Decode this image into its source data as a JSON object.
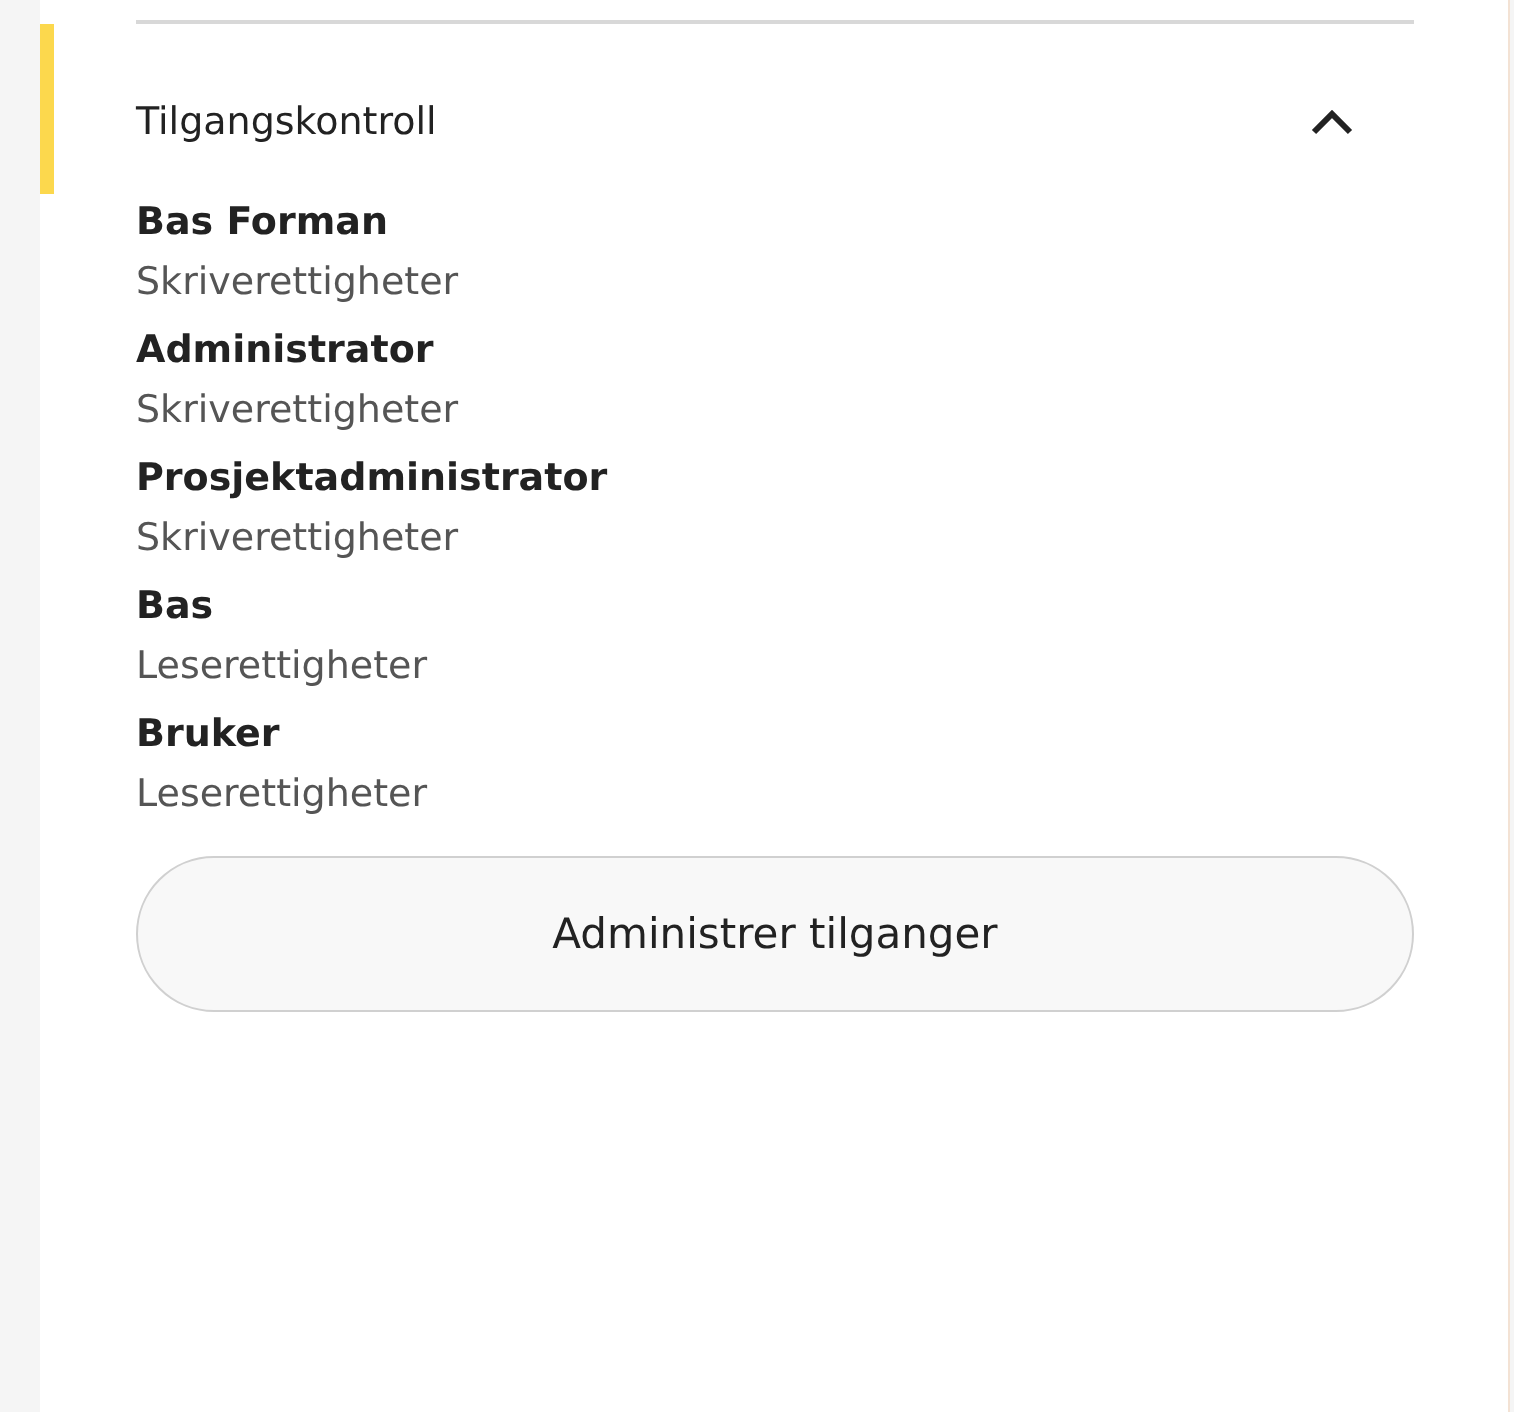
{
  "section": {
    "title": "Tilgangskontroll",
    "expanded": true,
    "highlighted": true,
    "roles": [
      {
        "name": "Bas Forman",
        "access": "Skriverettigheter"
      },
      {
        "name": "Administrator",
        "access": "Skriverettigheter"
      },
      {
        "name": "Prosjektadministrator",
        "access": "Skriverettigheter"
      },
      {
        "name": "Bas",
        "access": "Leserettigheter"
      },
      {
        "name": "Bruker",
        "access": "Leserettigheter"
      }
    ],
    "button": "Administrer tilganger"
  }
}
